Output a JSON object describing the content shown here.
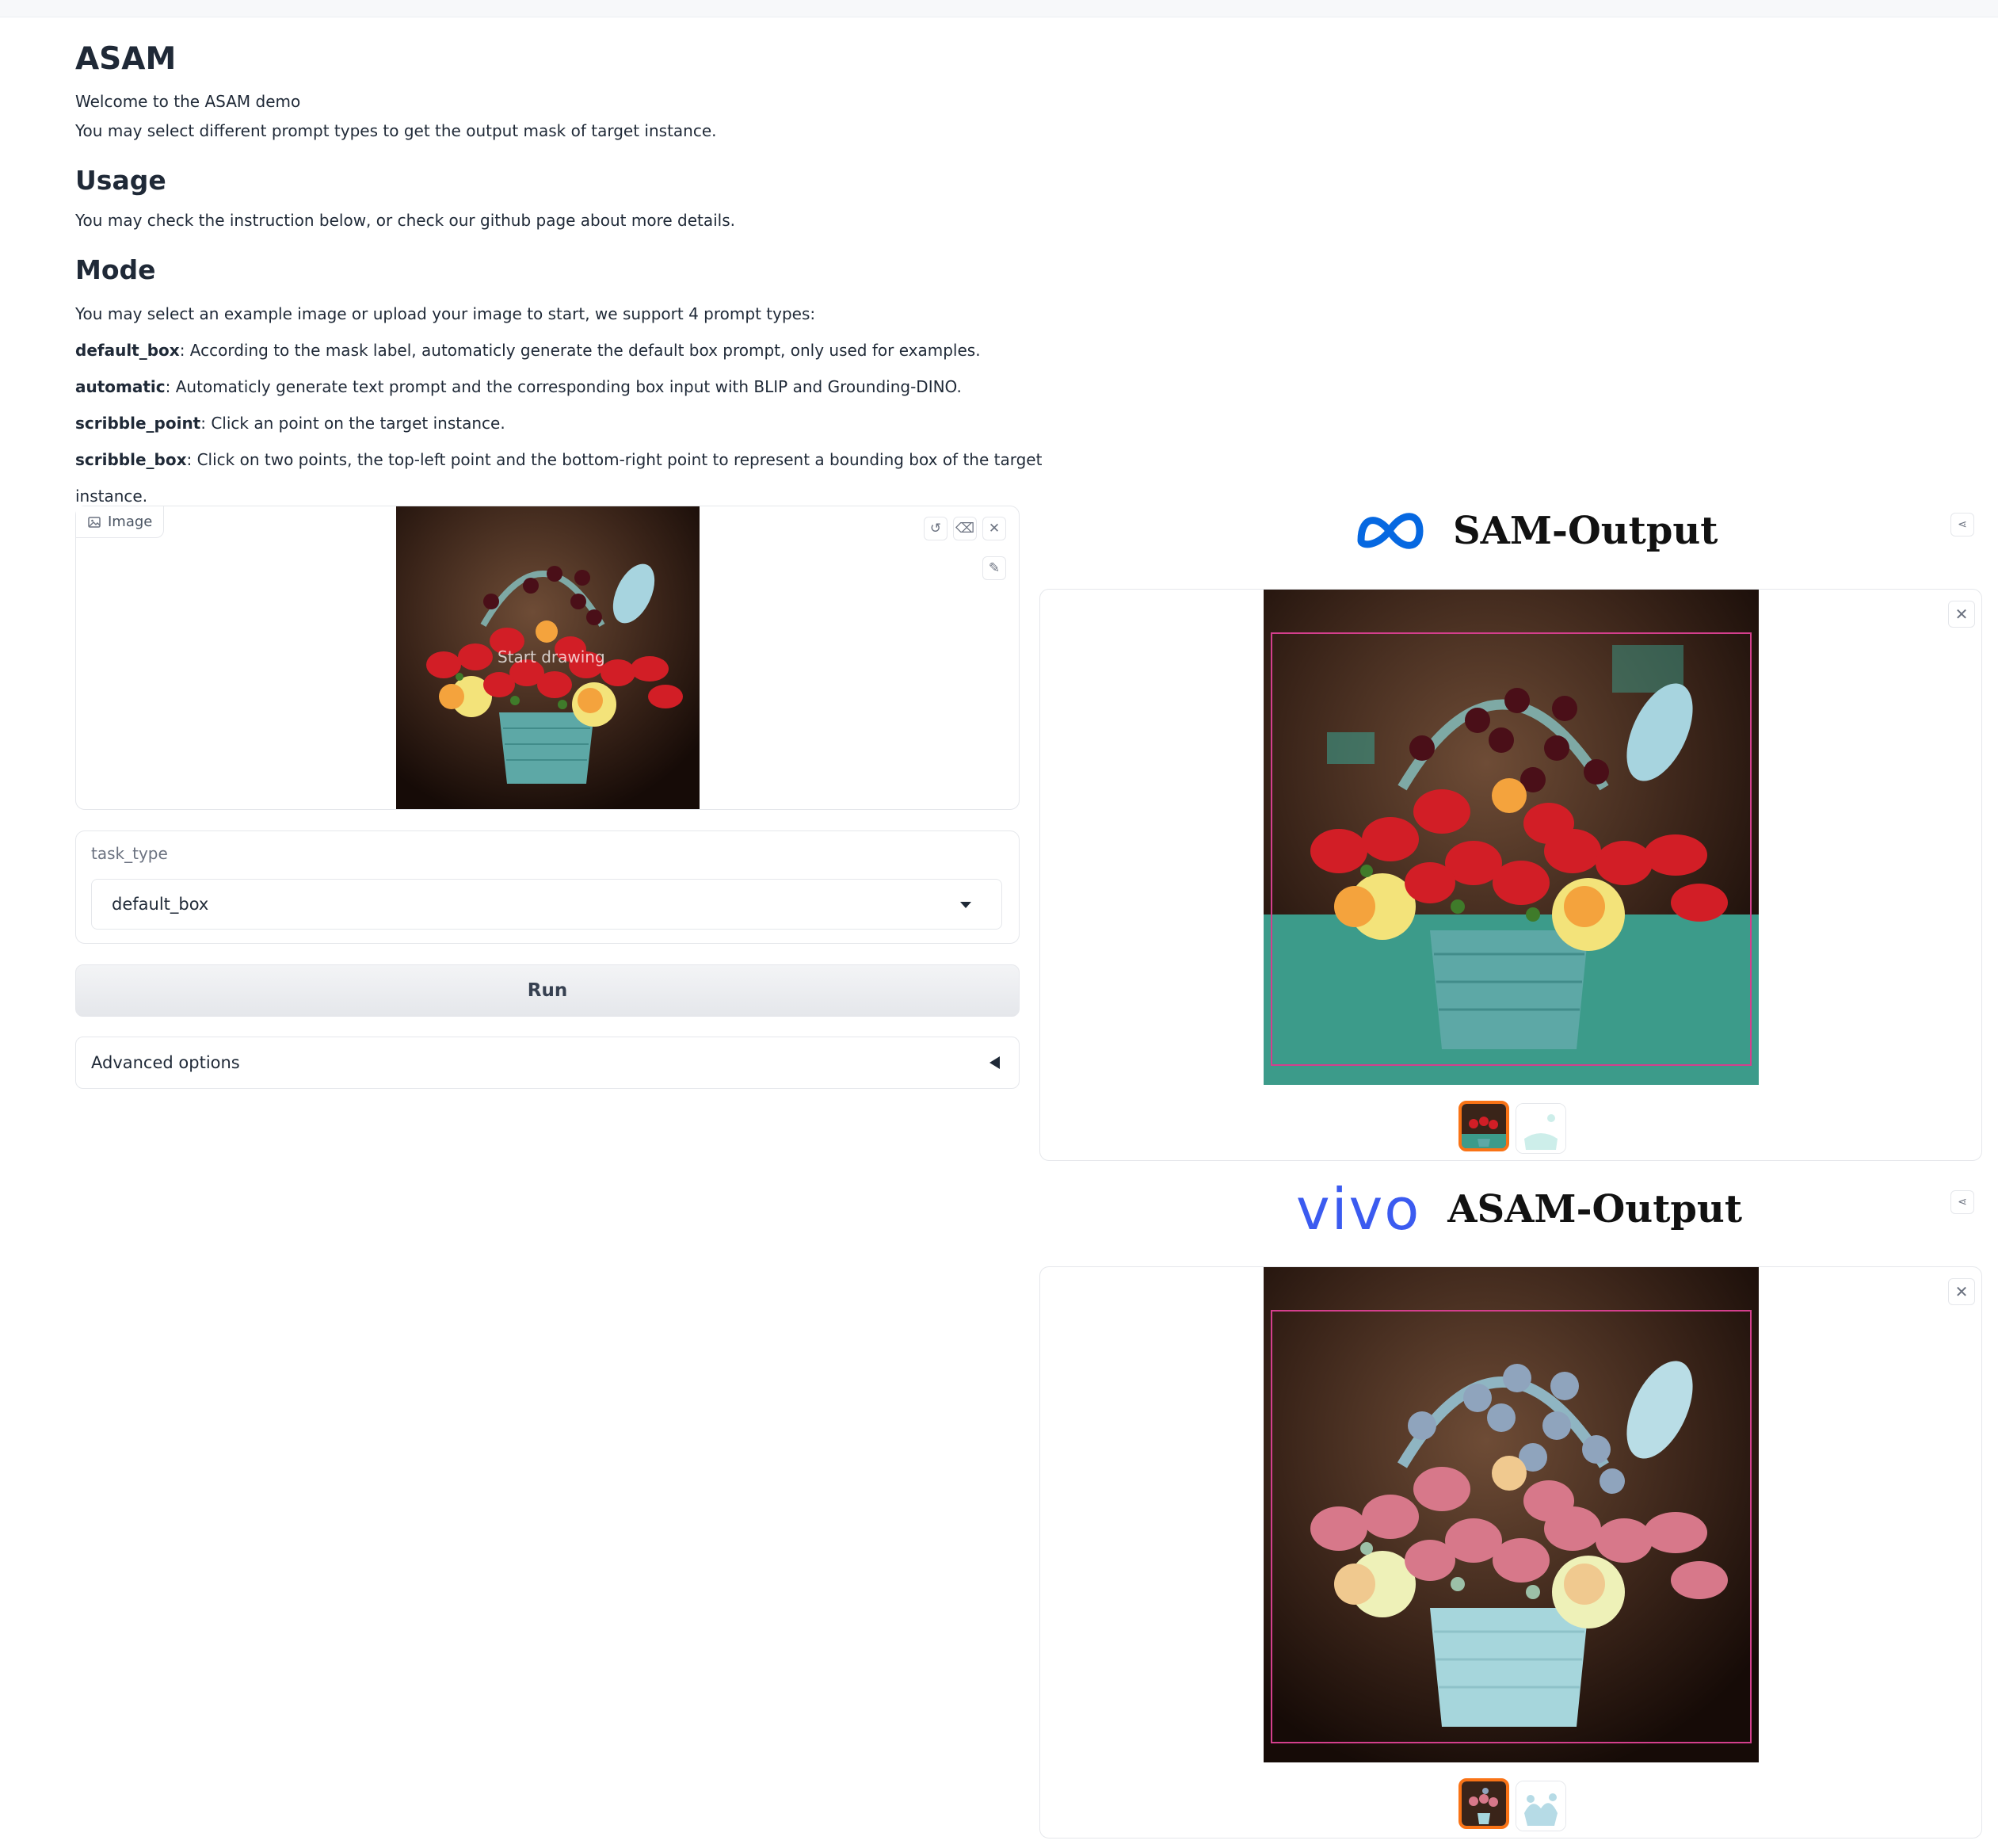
{
  "page": {
    "title": "ASAM",
    "welcome": "Welcome to the ASAM demo",
    "subtitle": "You may select different prompt types to get the output mask of target instance.",
    "usage_heading": "Usage",
    "usage_text": "You may check the instruction below, or check our github page about more details.",
    "mode_heading": "Mode",
    "mode_intro": "You may select an example image or upload your image to start, we support 4 prompt types:",
    "modes": [
      {
        "name": "default_box",
        "desc": ": According to the mask label, automaticly generate the default box prompt, only used for examples."
      },
      {
        "name": "automatic",
        "desc": ": Automaticly generate text prompt and the corresponding box input with BLIP and Grounding-DINO."
      },
      {
        "name": "scribble_point",
        "desc": ": Click an point on the target instance."
      },
      {
        "name": "scribble_box",
        "desc": ": Click on two points, the top-left point and the bottom-right point to represent a bounding box of the target instance."
      }
    ]
  },
  "image_input": {
    "label": "Image",
    "hint": "Start drawing",
    "icons": [
      "undo-icon",
      "eraser-icon",
      "close-icon",
      "brush-icon"
    ]
  },
  "task": {
    "label": "task_type",
    "selected": "default_box"
  },
  "run_label": "Run",
  "advanced_label": "Advanced options",
  "outputs": [
    {
      "title": "SAM-Output",
      "logo": "meta-logo-icon"
    },
    {
      "title": "ASAM-Output",
      "logo": "vivo",
      "logo_text": "vivo"
    }
  ],
  "colors": {
    "accent": "#f97316",
    "meta_blue": "#0668e1",
    "vivo_blue": "#3b5bf0",
    "box_magenta": "#d43f8d",
    "mask_teal": "#52c4b4"
  }
}
